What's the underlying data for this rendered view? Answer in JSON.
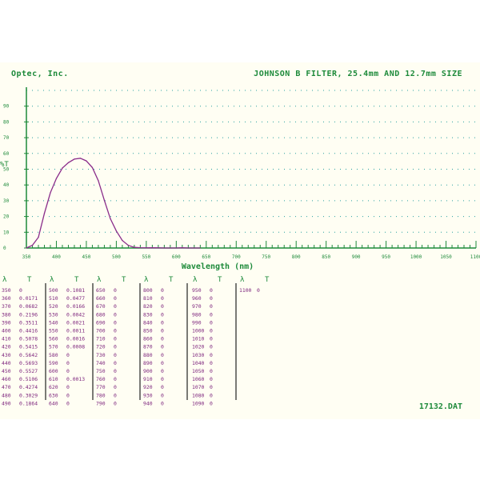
{
  "header": {
    "company": "Optec, Inc.",
    "title": "JOHNSON B FILTER, 25.4mm AND 12.7mm SIZE"
  },
  "footer": {
    "file": "17132.DAT"
  },
  "colors": {
    "axis": "#1d8a3a",
    "curve": "#8a2c8a",
    "grid": "#2aa0a0",
    "table_text": "#7a1f7a"
  },
  "chart_data": {
    "type": "line",
    "xlabel": "Wavelength (nm)",
    "ylabel": "%T",
    "xlim": [
      350,
      1100
    ],
    "ylim": [
      0,
      100
    ],
    "x_ticks": [
      "350",
      "400",
      "450",
      "500",
      "550",
      "600",
      "650",
      "700",
      "750",
      "800",
      "850",
      "900",
      "950",
      "1000",
      "1050",
      "1100"
    ],
    "y_ticks": [
      "0",
      "10",
      "20",
      "30",
      "40",
      "50",
      "60",
      "70",
      "80",
      "90"
    ],
    "grid": true,
    "series": [
      {
        "x": [
          350,
          360,
          370,
          380,
          390,
          400,
          410,
          420,
          430,
          440,
          450,
          460,
          470,
          480,
          490,
          500,
          510,
          520,
          530,
          540,
          550,
          560,
          570,
          580,
          590,
          600,
          610,
          620,
          630,
          640
        ],
        "y": [
          0,
          1.71,
          6.82,
          21.96,
          35.11,
          44.16,
          50.78,
          54.15,
          56.42,
          56.93,
          55.27,
          51.06,
          42.74,
          30.29,
          18.64,
          10.81,
          4.77,
          1.66,
          0.42,
          0.21,
          0.11,
          0.16,
          0.08,
          0,
          0,
          0,
          0.13,
          0,
          0,
          0
        ]
      }
    ]
  },
  "table": {
    "col_head_lambda": "λ",
    "col_head_t": "T",
    "groups": [
      {
        "rows": [
          [
            "350",
            "0"
          ],
          [
            "360",
            "0.0171"
          ],
          [
            "370",
            "0.0682"
          ],
          [
            "380",
            "0.2196"
          ],
          [
            "390",
            "0.3511"
          ],
          [
            "400",
            "0.4416"
          ],
          [
            "410",
            "0.5078"
          ],
          [
            "420",
            "0.5415"
          ],
          [
            "430",
            "0.5642"
          ],
          [
            "440",
            "0.5693"
          ],
          [
            "450",
            "0.5527"
          ],
          [
            "460",
            "0.5106"
          ],
          [
            "470",
            "0.4274"
          ],
          [
            "480",
            "0.3029"
          ],
          [
            "490",
            "0.1864"
          ]
        ]
      },
      {
        "rows": [
          [
            "500",
            "0.1081"
          ],
          [
            "510",
            "0.0477"
          ],
          [
            "520",
            "0.0166"
          ],
          [
            "530",
            "0.0042"
          ],
          [
            "540",
            "0.0021"
          ],
          [
            "550",
            "0.0011"
          ],
          [
            "560",
            "0.0016"
          ],
          [
            "570",
            "0.0008"
          ],
          [
            "580",
            "0"
          ],
          [
            "590",
            "0"
          ],
          [
            "600",
            "0"
          ],
          [
            "610",
            "0.0013"
          ],
          [
            "620",
            "0"
          ],
          [
            "630",
            "0"
          ],
          [
            "640",
            "0"
          ]
        ]
      },
      {
        "rows": [
          [
            "650",
            "0"
          ],
          [
            "660",
            "0"
          ],
          [
            "670",
            "0"
          ],
          [
            "680",
            "0"
          ],
          [
            "690",
            "0"
          ],
          [
            "700",
            "0"
          ],
          [
            "710",
            "0"
          ],
          [
            "720",
            "0"
          ],
          [
            "730",
            "0"
          ],
          [
            "740",
            "0"
          ],
          [
            "750",
            "0"
          ],
          [
            "760",
            "0"
          ],
          [
            "770",
            "0"
          ],
          [
            "780",
            "0"
          ],
          [
            "790",
            "0"
          ]
        ]
      },
      {
        "rows": [
          [
            "800",
            "0"
          ],
          [
            "810",
            "0"
          ],
          [
            "820",
            "0"
          ],
          [
            "830",
            "0"
          ],
          [
            "840",
            "0"
          ],
          [
            "850",
            "0"
          ],
          [
            "860",
            "0"
          ],
          [
            "870",
            "0"
          ],
          [
            "880",
            "0"
          ],
          [
            "890",
            "0"
          ],
          [
            "900",
            "0"
          ],
          [
            "910",
            "0"
          ],
          [
            "920",
            "0"
          ],
          [
            "930",
            "0"
          ],
          [
            "940",
            "0"
          ]
        ]
      },
      {
        "rows": [
          [
            "950",
            "0"
          ],
          [
            "960",
            "0"
          ],
          [
            "970",
            "0"
          ],
          [
            "980",
            "0"
          ],
          [
            "990",
            "0"
          ],
          [
            "1000",
            "0"
          ],
          [
            "1010",
            "0"
          ],
          [
            "1020",
            "0"
          ],
          [
            "1030",
            "0"
          ],
          [
            "1040",
            "0"
          ],
          [
            "1050",
            "0"
          ],
          [
            "1060",
            "0"
          ],
          [
            "1070",
            "0"
          ],
          [
            "1080",
            "0"
          ],
          [
            "1090",
            "0"
          ]
        ]
      },
      {
        "rows": [
          [
            "1100",
            "0"
          ]
        ]
      }
    ]
  }
}
